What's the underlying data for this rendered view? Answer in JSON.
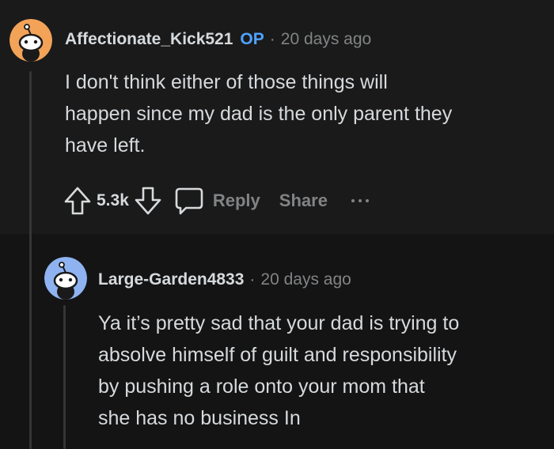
{
  "comment1": {
    "username": "Affectionate_Kick521",
    "op_badge": "OP",
    "separator": "·",
    "timestamp": "20 days ago",
    "body_lines": [
      "I don't think either of those things will",
      "happen since my dad is the only parent they",
      "have left."
    ],
    "score": "5.3k",
    "reply_label": "Reply",
    "share_label": "Share",
    "avatar_color": "#f2a358"
  },
  "comment2": {
    "username": "Large-Garden4833",
    "separator": "·",
    "timestamp": "20 days ago",
    "body_lines": [
      "Ya it’s pretty sad that your dad is trying to",
      "absolve himself of guilt and responsibility",
      "by pushing a role onto your mom that",
      "she has no business In"
    ],
    "avatar_color": "#8fb3f0"
  },
  "icons": [
    "reddit-snoo-avatar-icon",
    "upvote-arrow-icon",
    "downvote-arrow-icon",
    "comment-bubble-icon",
    "more-options-icon"
  ]
}
